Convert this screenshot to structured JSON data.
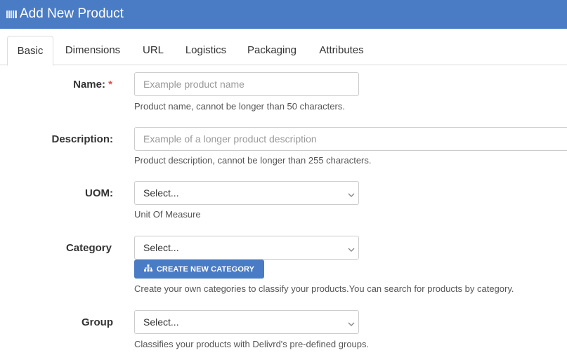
{
  "header": {
    "title": "Add New Product",
    "icon": "barcode-icon",
    "color": "#4a7bc5"
  },
  "tabs": [
    {
      "label": "Basic",
      "active": true
    },
    {
      "label": "Dimensions"
    },
    {
      "label": "URL"
    },
    {
      "label": "Logistics"
    },
    {
      "label": "Packaging"
    },
    {
      "label": "Attributes"
    }
  ],
  "form": {
    "name": {
      "label": "Name:",
      "required_mark": "*",
      "placeholder": "Example product name",
      "help": "Product name, cannot be longer than 50 characters."
    },
    "description": {
      "label": "Description:",
      "placeholder": "Example of a longer product description",
      "help": "Product description, cannot be longer than 255 characters."
    },
    "uom": {
      "label": "UOM:",
      "value": "Select...",
      "help": "Unit Of Measure"
    },
    "category": {
      "label": "Category",
      "value": "Select...",
      "button_label": "CREATE NEW CATEGORY",
      "button_icon": "sitemap-icon",
      "help": "Create your own categories to classify your products.You can search for products by category."
    },
    "group": {
      "label": "Group",
      "value": "Select...",
      "help": "Classifies your products with Delivrd's pre-defined groups."
    }
  }
}
